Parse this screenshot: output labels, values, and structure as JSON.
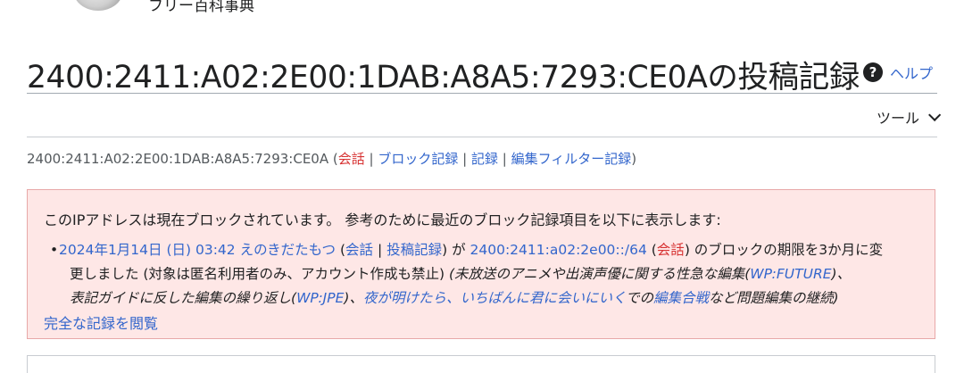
{
  "site": {
    "tagline": "フリー百科事典"
  },
  "page": {
    "title": "2400:2411:A02:2E00:1DAB:A8A5:7293:CE0Aの投稿記録",
    "help_label": "ヘルプ",
    "tools_label": "ツール"
  },
  "subtitle": {
    "ip": "2400:2411:A02:2E00:1DAB:A8A5:7293:CE0A",
    "open_paren": " (",
    "talk": "会話",
    "sep": " | ",
    "block_log": "ブロック記録",
    "logs": "記録",
    "abuse_log": "編集フィルター記録",
    "close_paren": ")"
  },
  "notice": {
    "header": "このIPアドレスは現在ブロックされています。 参考のために最近のブロック記録項目を以下に表示します:",
    "entry": {
      "date": "2024年1月14日 (日) 03:42",
      "user": "えのきだたもつ",
      "user_talk": "会話",
      "user_contribs": "投稿記録",
      "range": "2400:2411:a02:2e00::/64",
      "range_talk": "会話",
      "action1": " のブロックの期限を3か月に変",
      "action2": "更しました (対象は匿名利用者のみ、アカウント作成も禁止)",
      "reason1": "(未放送のアニメや出演声優に関する性急な編集(",
      "wp_future": "WP:FUTURE",
      "reason2": ")、",
      "reason3": "表記ガイドに反した編集の繰り返し(",
      "wp_jpe": "WP:JPE",
      "reason4": ")、",
      "article": "夜が明けたら、いちばんに君に会いにいく",
      "reason5": "での",
      "edit_war": "編集合戦",
      "reason6": "など問題編集の継続)"
    },
    "view_full": "完全な記録を閲覧"
  },
  "colors": {
    "link": "#3366cc",
    "redlink": "#d73333",
    "notice_bg": "#fee7e6",
    "notice_border": "#e8a8a8"
  },
  "icons": {
    "help": "question-circle-icon",
    "tools_dropdown": "chevron-down-icon",
    "logo": "wikipedia-globe-icon"
  }
}
